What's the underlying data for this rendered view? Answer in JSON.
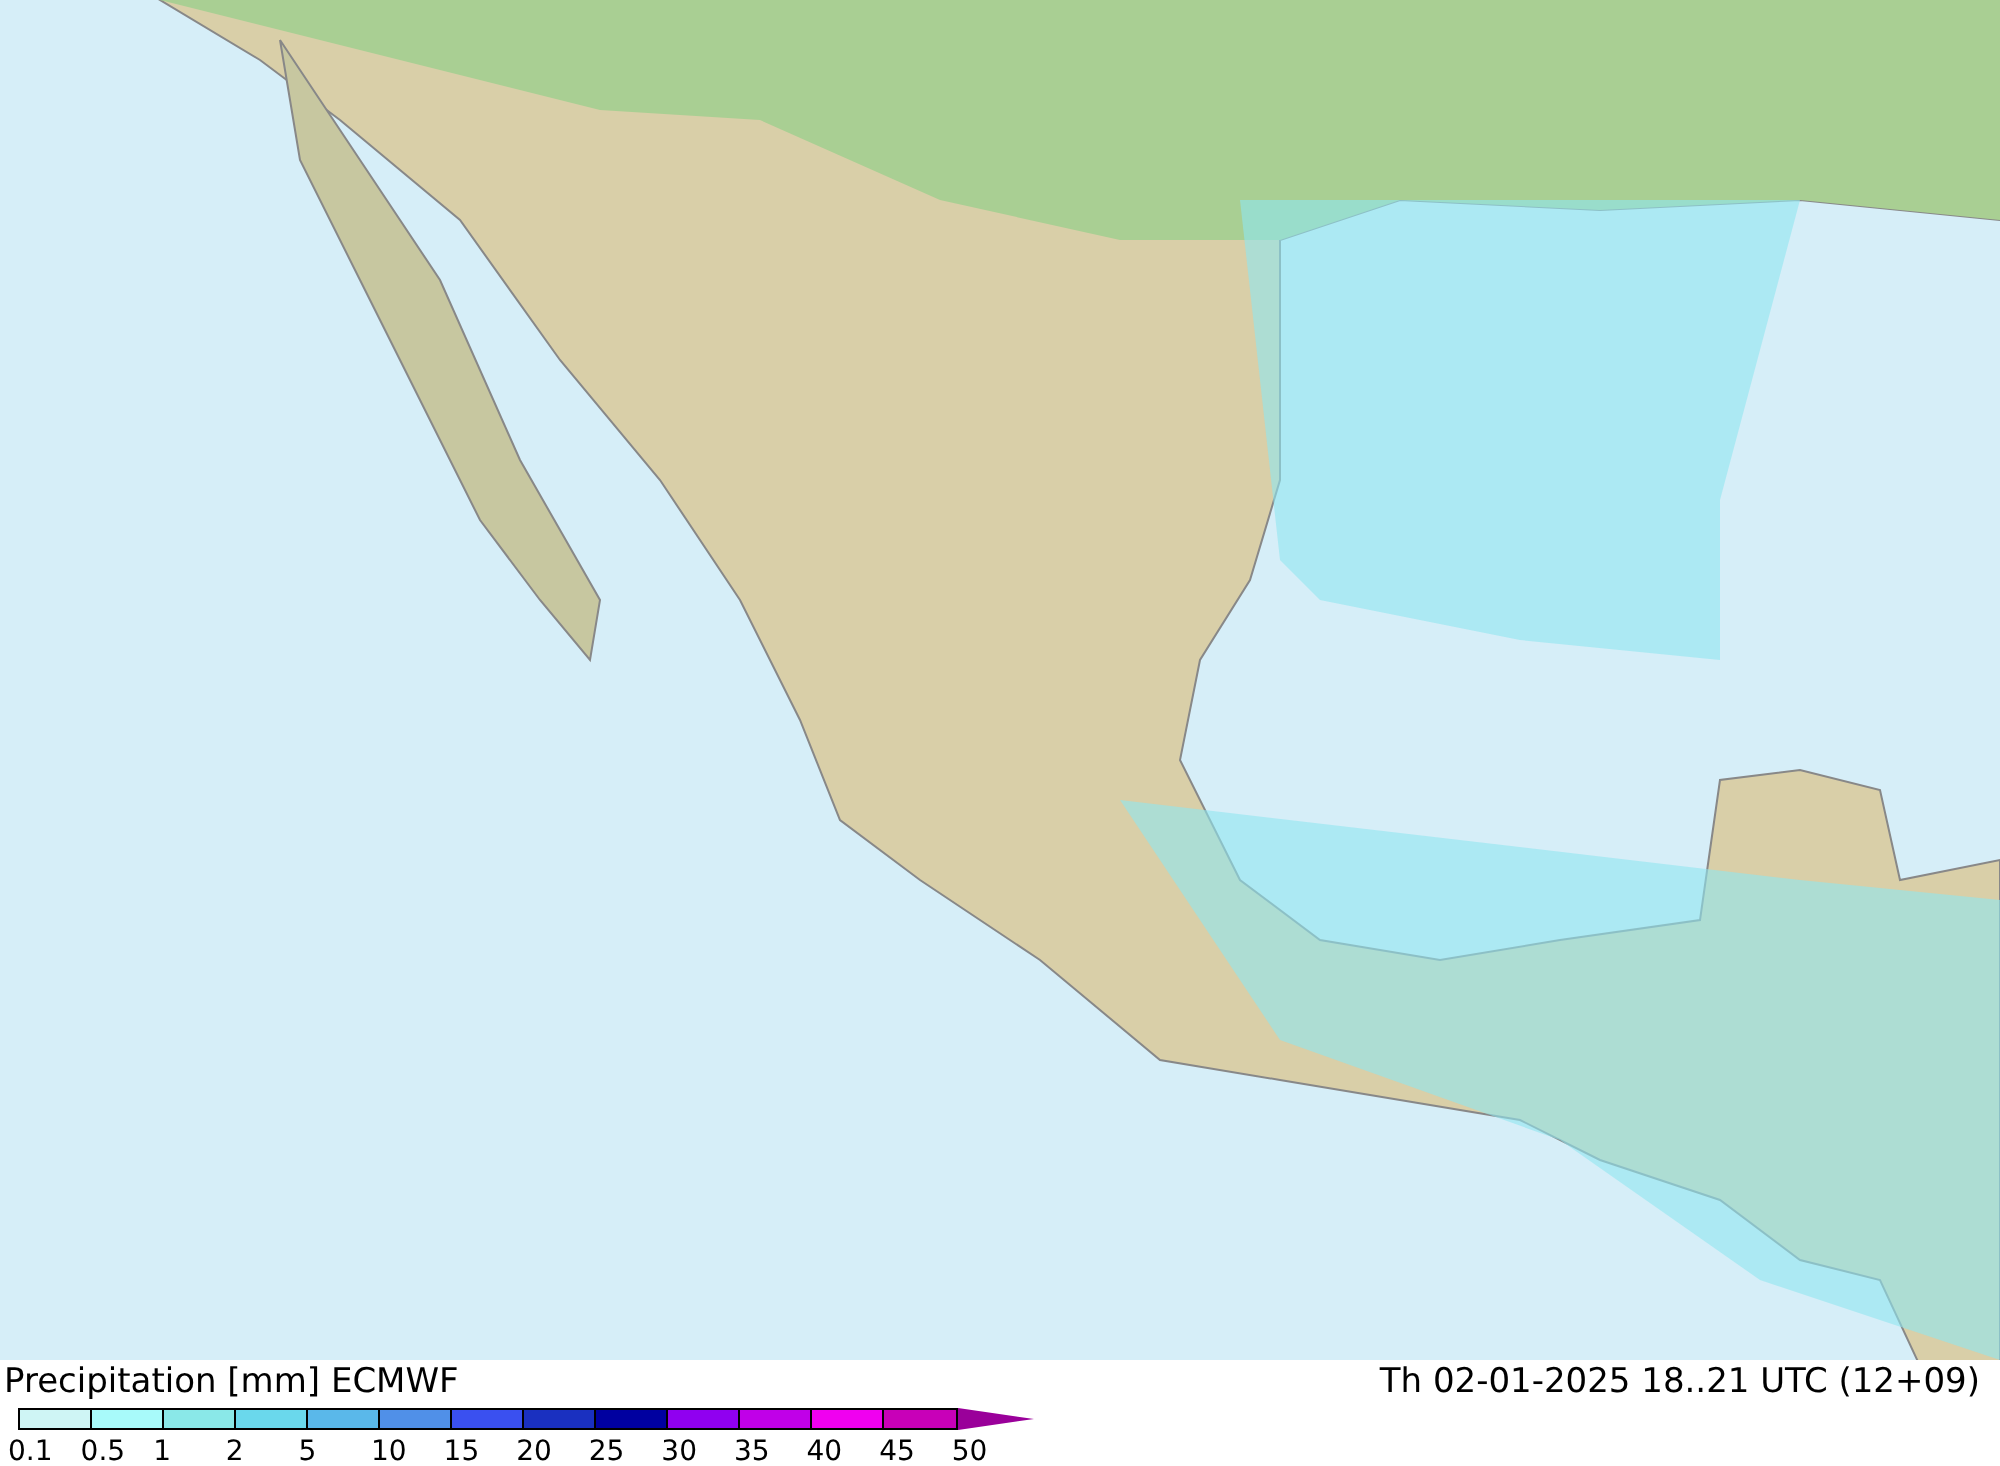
{
  "map": {
    "kind": "precipitation-map"
  },
  "footer": {
    "title": "Precipitation [mm] ECMWF",
    "valid_time": "Th 02-01-2025 18..21 UTC (12+09)"
  },
  "legend": {
    "bins": [
      {
        "color": "#cff5f5"
      },
      {
        "color": "#a8fafa"
      },
      {
        "color": "#8ae8e8"
      },
      {
        "color": "#6ad8ec"
      },
      {
        "color": "#5ab8ea"
      },
      {
        "color": "#5090e8"
      },
      {
        "color": "#3a50f0"
      },
      {
        "color": "#1a30c0"
      },
      {
        "color": "#0000a0"
      },
      {
        "color": "#9000f0"
      },
      {
        "color": "#c000e8"
      },
      {
        "color": "#f000f0"
      },
      {
        "color": "#c800b8"
      }
    ],
    "ticks": [
      "0.1",
      "0.5",
      "1",
      "2",
      "5",
      "10",
      "15",
      "20",
      "25",
      "30",
      "35",
      "40",
      "45",
      "50"
    ]
  }
}
